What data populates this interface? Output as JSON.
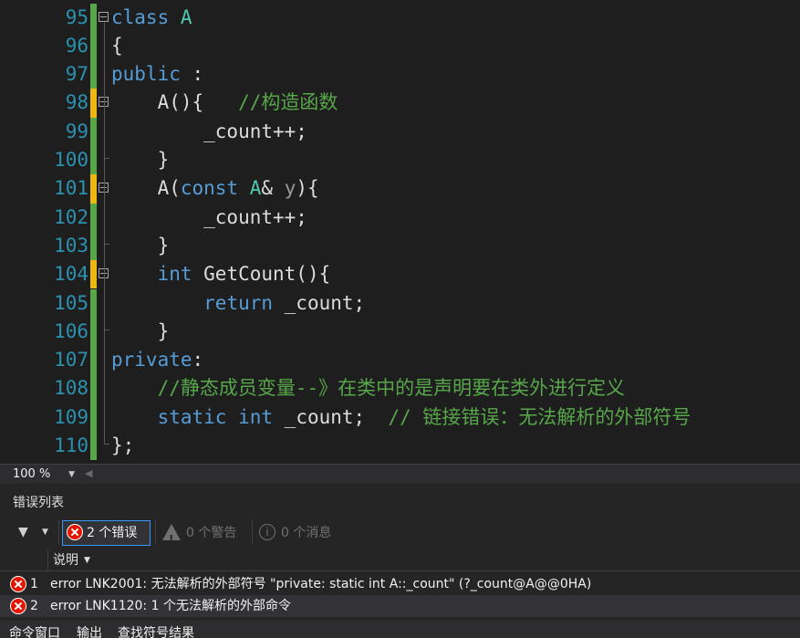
{
  "editor": {
    "lines": [
      {
        "number": "95",
        "tokens": [
          {
            "t": "class",
            "c": "kw"
          },
          {
            "t": " "
          },
          {
            "t": "A",
            "c": "ty"
          }
        ]
      },
      {
        "number": "96",
        "tokens": [
          {
            "t": "{"
          }
        ]
      },
      {
        "number": "97",
        "tokens": [
          {
            "t": "public",
            "c": "kw"
          },
          {
            "t": " :"
          }
        ]
      },
      {
        "number": "98",
        "tokens": [
          {
            "t": "    A(){   "
          },
          {
            "t": "//构造函数",
            "c": "cm"
          }
        ]
      },
      {
        "number": "99",
        "tokens": [
          {
            "t": "        _count++;"
          }
        ]
      },
      {
        "number": "100",
        "tokens": [
          {
            "t": "    }"
          }
        ]
      },
      {
        "number": "101",
        "tokens": [
          {
            "t": "    A("
          },
          {
            "t": "const",
            "c": "kw"
          },
          {
            "t": " "
          },
          {
            "t": "A",
            "c": "ty"
          },
          {
            "t": "& "
          },
          {
            "t": "y",
            "c": "pm"
          },
          {
            "t": "){"
          }
        ]
      },
      {
        "number": "102",
        "tokens": [
          {
            "t": "        _count++;"
          }
        ]
      },
      {
        "number": "103",
        "tokens": [
          {
            "t": "    }"
          }
        ]
      },
      {
        "number": "104",
        "tokens": [
          {
            "t": "    "
          },
          {
            "t": "int",
            "c": "kw"
          },
          {
            "t": " GetCount(){"
          }
        ]
      },
      {
        "number": "105",
        "tokens": [
          {
            "t": "        "
          },
          {
            "t": "return",
            "c": "kw"
          },
          {
            "t": " _count;"
          }
        ]
      },
      {
        "number": "106",
        "tokens": [
          {
            "t": "    }"
          }
        ]
      },
      {
        "number": "107",
        "tokens": [
          {
            "t": "private",
            "c": "kw"
          },
          {
            "t": ":"
          }
        ]
      },
      {
        "number": "108",
        "tokens": [
          {
            "t": "    "
          },
          {
            "t": "//静态成员变量--》在类中的是声明要在类外进行定义",
            "c": "cm"
          }
        ]
      },
      {
        "number": "109",
        "tokens": [
          {
            "t": "    "
          },
          {
            "t": "static",
            "c": "kw"
          },
          {
            "t": " "
          },
          {
            "t": "int",
            "c": "kw"
          },
          {
            "t": " _count;  "
          },
          {
            "t": "// 链接错误：无法解析的外部符号",
            "c": "cm"
          }
        ]
      },
      {
        "number": "110",
        "tokens": [
          {
            "t": "};"
          }
        ]
      }
    ]
  },
  "zoom": {
    "value": "100 %"
  },
  "error_list": {
    "title": "错误列表",
    "errors_label": "2 个错误",
    "warnings_label": "0 个警告",
    "messages_label": "0 个消息",
    "column_description": "说明",
    "rows": [
      {
        "num": "1",
        "description": "error LNK2001: 无法解析的外部符号 \"private: static int A::_count\" (?_count@A@@0HA)"
      },
      {
        "num": "2",
        "description": "error LNK1120: 1 个无法解析的外部命令"
      }
    ]
  },
  "bottom_tabs": [
    "命令窗口",
    "输出",
    "查找符号结果"
  ],
  "colors": {
    "keyword": "#569cd6",
    "type": "#4ec9b0",
    "comment": "#57a64a",
    "line_number": "#2b91af",
    "error": "#e51400",
    "saved_change": "#57a64a",
    "unsaved_change": "#efb810"
  },
  "icons": [
    "collapse-icon",
    "filter-icon",
    "error-icon",
    "warning-icon",
    "info-icon",
    "dropdown-arrow-icon"
  ]
}
